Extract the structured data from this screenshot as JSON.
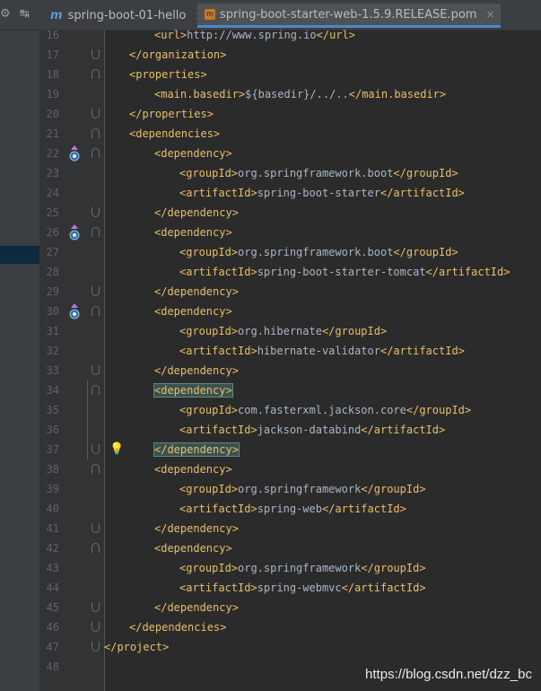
{
  "toolbar": {
    "gear": "⚙",
    "arrow": "↹"
  },
  "tabs": [
    {
      "icon": "m",
      "label": "spring-boot-01-hello",
      "close": "×",
      "active": false
    },
    {
      "icon": "pom",
      "label": "spring-boot-starter-web-1.5.9.RELEASE.pom",
      "close": "×",
      "active": true
    }
  ],
  "lines": [
    {
      "n": "16",
      "indent": 2,
      "open": "<url>",
      "text": "http://www.spring.io",
      "close": "</url>"
    },
    {
      "n": "17",
      "indent": 1,
      "open": "",
      "text": "",
      "close": "</organization>"
    },
    {
      "n": "18",
      "indent": 1,
      "open": "<properties>",
      "text": "",
      "close": ""
    },
    {
      "n": "19",
      "indent": 2,
      "open": "<main.basedir>",
      "text": "${basedir}/../..",
      "close": "</main.basedir>"
    },
    {
      "n": "20",
      "indent": 1,
      "open": "",
      "text": "",
      "close": "</properties>"
    },
    {
      "n": "21",
      "indent": 1,
      "open": "<dependencies>",
      "text": "",
      "close": ""
    },
    {
      "n": "22",
      "indent": 2,
      "open": "<dependency>",
      "text": "",
      "close": ""
    },
    {
      "n": "23",
      "indent": 3,
      "open": "<groupId>",
      "text": "org.springframework.boot",
      "close": "</groupId>"
    },
    {
      "n": "24",
      "indent": 3,
      "open": "<artifactId>",
      "text": "spring-boot-starter",
      "close": "</artifactId>"
    },
    {
      "n": "25",
      "indent": 2,
      "open": "",
      "text": "",
      "close": "</dependency>"
    },
    {
      "n": "26",
      "indent": 2,
      "open": "<dependency>",
      "text": "",
      "close": ""
    },
    {
      "n": "27",
      "indent": 3,
      "open": "<groupId>",
      "text": "org.springframework.boot",
      "close": "</groupId>"
    },
    {
      "n": "28",
      "indent": 3,
      "open": "<artifactId>",
      "text": "spring-boot-starter-tomcat",
      "close": "</artifactId>"
    },
    {
      "n": "29",
      "indent": 2,
      "open": "",
      "text": "",
      "close": "</dependency>"
    },
    {
      "n": "30",
      "indent": 2,
      "open": "<dependency>",
      "text": "",
      "close": ""
    },
    {
      "n": "31",
      "indent": 3,
      "open": "<groupId>",
      "text": "org.hibernate",
      "close": "</groupId>"
    },
    {
      "n": "32",
      "indent": 3,
      "open": "<artifactId>",
      "text": "hibernate-validator",
      "close": "</artifactId>"
    },
    {
      "n": "33",
      "indent": 2,
      "open": "",
      "text": "",
      "close": "</dependency>"
    },
    {
      "n": "34",
      "indent": 2,
      "open": "<dependency>",
      "text": "",
      "close": ""
    },
    {
      "n": "35",
      "indent": 3,
      "open": "<groupId>",
      "text": "com.fasterxml.jackson.core",
      "close": "</groupId>"
    },
    {
      "n": "36",
      "indent": 3,
      "open": "<artifactId>",
      "text": "jackson-databind",
      "close": "</artifactId>"
    },
    {
      "n": "37",
      "indent": 2,
      "open": "",
      "text": "",
      "close": "</dependency>"
    },
    {
      "n": "38",
      "indent": 2,
      "open": "<dependency>",
      "text": "",
      "close": ""
    },
    {
      "n": "39",
      "indent": 3,
      "open": "<groupId>",
      "text": "org.springframework",
      "close": "</groupId>"
    },
    {
      "n": "40",
      "indent": 3,
      "open": "<artifactId>",
      "text": "spring-web",
      "close": "</artifactId>"
    },
    {
      "n": "41",
      "indent": 2,
      "open": "",
      "text": "",
      "close": "</dependency>"
    },
    {
      "n": "42",
      "indent": 2,
      "open": "<dependency>",
      "text": "",
      "close": ""
    },
    {
      "n": "43",
      "indent": 3,
      "open": "<groupId>",
      "text": "org.springframework",
      "close": "</groupId>"
    },
    {
      "n": "44",
      "indent": 3,
      "open": "<artifactId>",
      "text": "spring-webmvc",
      "close": "</artifactId>"
    },
    {
      "n": "45",
      "indent": 2,
      "open": "",
      "text": "",
      "close": "</dependency>"
    },
    {
      "n": "46",
      "indent": 1,
      "open": "",
      "text": "",
      "close": "</dependencies>"
    },
    {
      "n": "47",
      "indent": 0,
      "open": "",
      "text": "",
      "close": "</project>"
    },
    {
      "n": "48",
      "indent": 0,
      "open": "",
      "text": "",
      "close": ""
    }
  ],
  "markers": [
    "22",
    "26",
    "30"
  ],
  "bulb_line": "37",
  "highlight_open": "34",
  "highlight_close": "37",
  "watermark": "https://blog.csdn.net/dzz_bc",
  "colors": {
    "tag": "#e8bf6a",
    "text": "#a9b7c6",
    "linenum": "#606366",
    "bg": "#2b2b2b"
  }
}
